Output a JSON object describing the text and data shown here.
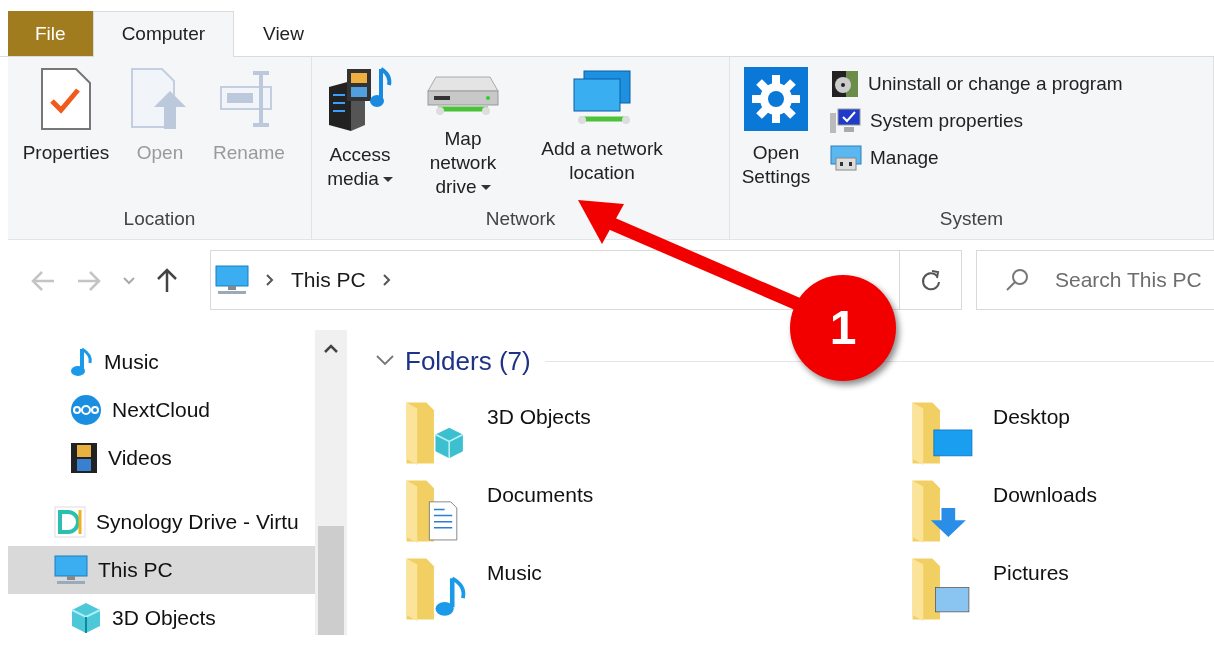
{
  "tabs": [
    {
      "label": "File",
      "kind": "file",
      "selected": false
    },
    {
      "label": "Computer",
      "kind": "tab",
      "selected": true
    },
    {
      "label": "View",
      "kind": "tab",
      "selected": false
    }
  ],
  "ribbon": {
    "groups": [
      {
        "label": "Location",
        "buttons": [
          {
            "label": "Properties",
            "disabled": false,
            "dropdown": false
          },
          {
            "label": "Open",
            "disabled": true,
            "dropdown": false
          },
          {
            "label": "Rename",
            "disabled": true,
            "dropdown": false
          }
        ]
      },
      {
        "label": "Network",
        "buttons": [
          {
            "label": "Access media",
            "disabled": false,
            "dropdown": true
          },
          {
            "label": "Map network drive",
            "disabled": false,
            "dropdown": true
          },
          {
            "label": "Add a network location",
            "disabled": false,
            "dropdown": false
          }
        ]
      },
      {
        "label": "System",
        "buttons": [
          {
            "label": "Open Settings",
            "disabled": false,
            "dropdown": false
          }
        ],
        "small_buttons": [
          {
            "label": "Uninstall or change a program"
          },
          {
            "label": "System properties"
          },
          {
            "label": "Manage"
          }
        ]
      }
    ]
  },
  "address_bar": {
    "back_disabled": true,
    "forward_disabled": true,
    "crumbs": [
      "This PC"
    ],
    "search": {
      "placeholder": "Search This PC"
    }
  },
  "nav_pane": {
    "scrolled_items": [
      {
        "label": "Music",
        "selected": false
      },
      {
        "label": "NextCloud",
        "selected": false
      },
      {
        "label": "Videos",
        "selected": false
      }
    ],
    "items": [
      {
        "label": "Synology Drive - Virtu",
        "selected": false
      },
      {
        "label": "This PC",
        "selected": true,
        "children": [
          {
            "label": "3D Objects",
            "selected": false
          }
        ]
      }
    ]
  },
  "content": {
    "group": {
      "label": "Folders (7)",
      "expanded": true
    },
    "folders": [
      {
        "label": "3D Objects"
      },
      {
        "label": "Desktop"
      },
      {
        "label": "Documents"
      },
      {
        "label": "Downloads"
      },
      {
        "label": "Music"
      },
      {
        "label": "Pictures"
      }
    ]
  },
  "callout": {
    "number": "1"
  }
}
